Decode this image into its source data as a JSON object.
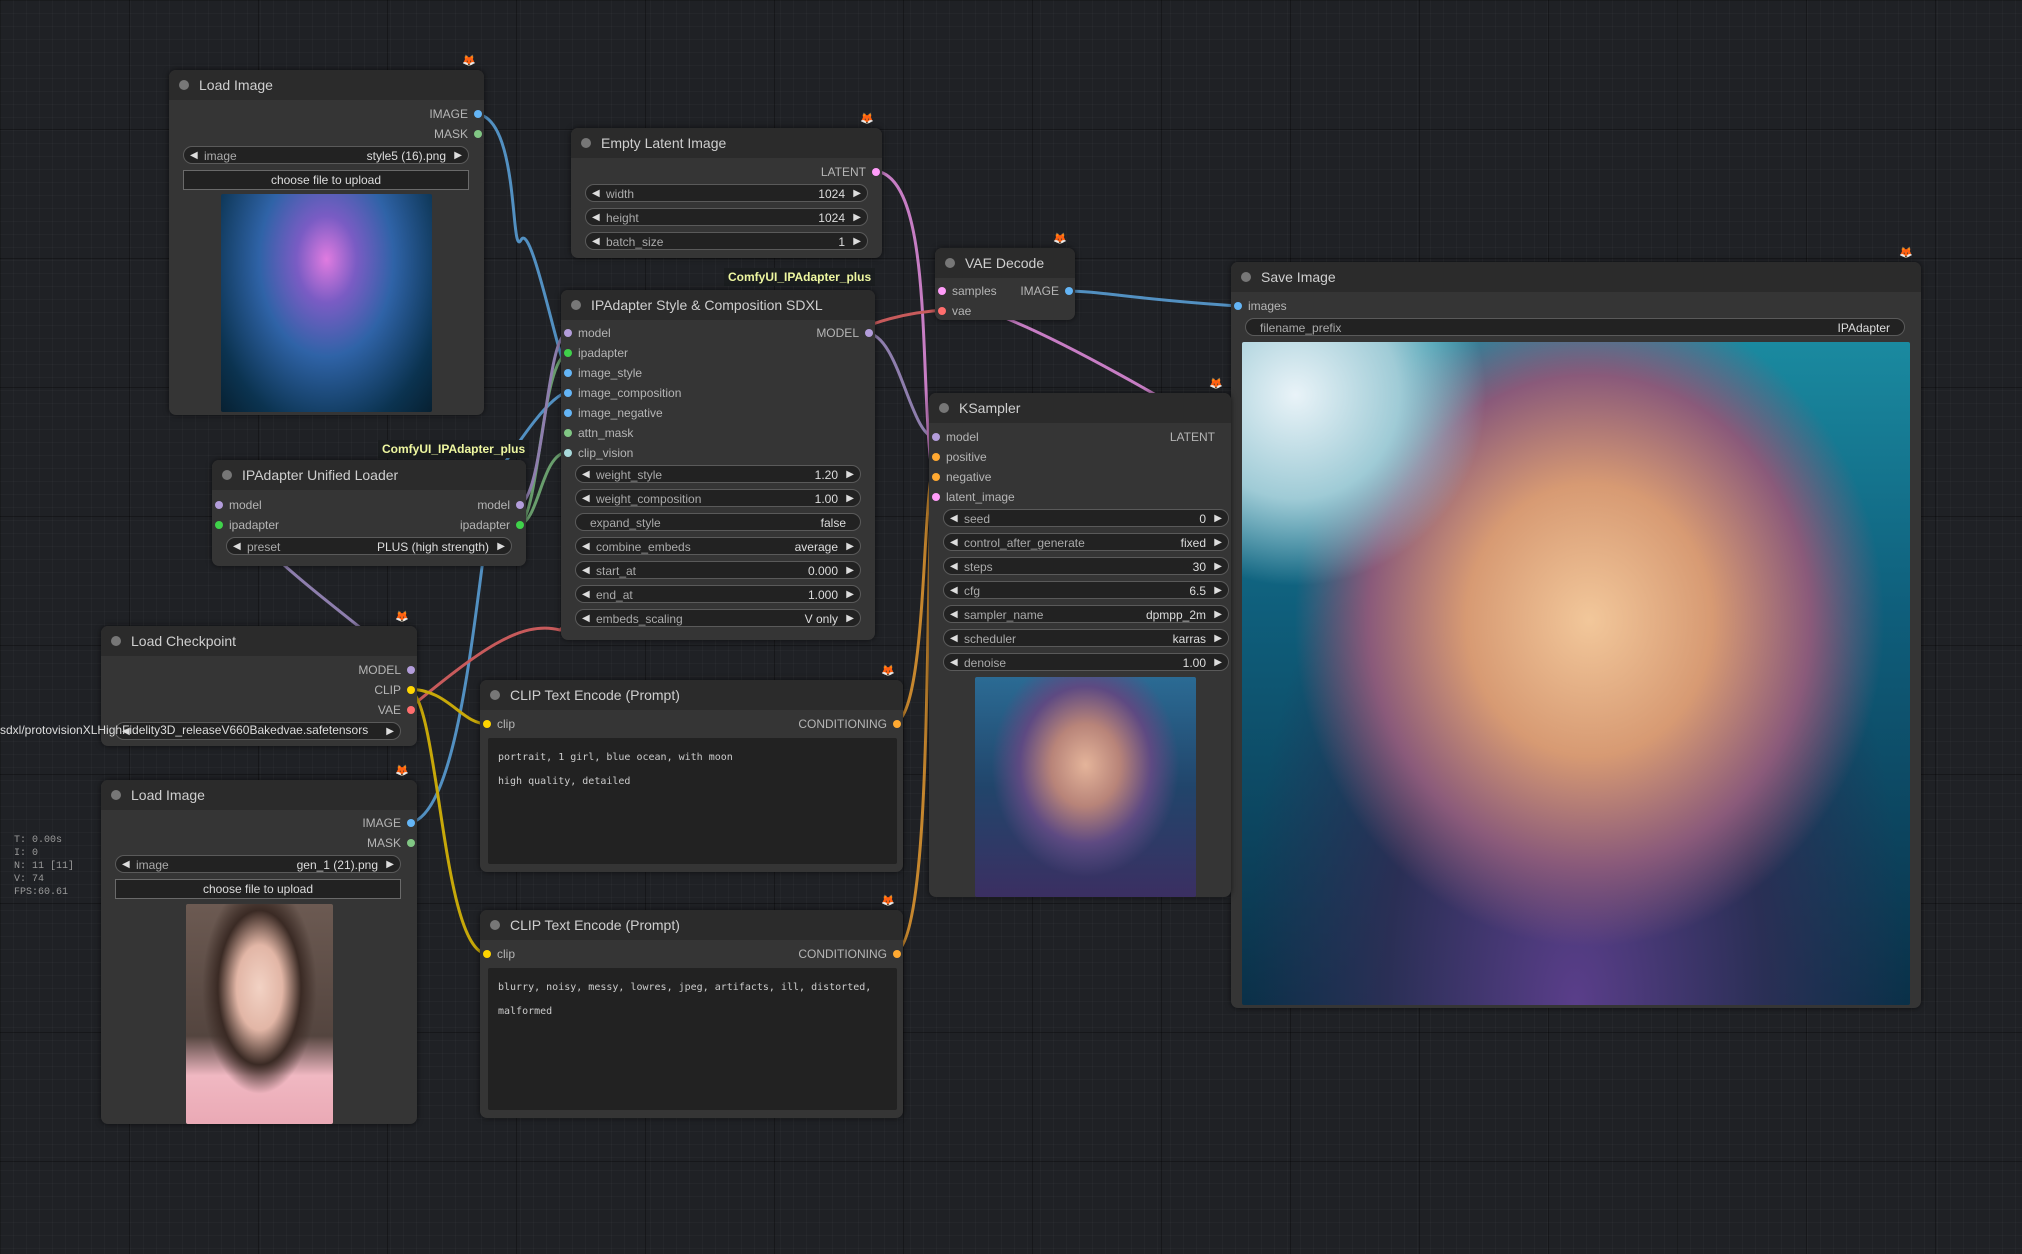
{
  "colors": {
    "model": "#b39ddb",
    "clip": "#ffd500",
    "vae": "#ff6e6e",
    "image": "#64b5f6",
    "latent": "#ff9cf9",
    "conditioning": "#ffa931",
    "mask": "#81c784",
    "ipadapter": "#3fd24a"
  },
  "groups": {
    "ipadapter_plus_a": "ComfyUI_IPAdapter_plus",
    "ipadapter_plus_b": "ComfyUI_IPAdapter_plus"
  },
  "stats": {
    "t": "T: 0.00s",
    "i": "I: 0",
    "n": "N: 11 [11]",
    "v": "V: 74",
    "fps": "FPS:60.61"
  },
  "left_path_label": "sdxl/protovisionXLHighFidelity3D_releaseV660Bakedvae.safetensors",
  "badge_icon": "fox-icon",
  "load_image_1": {
    "title": "Load Image",
    "outputs": [
      "IMAGE",
      "MASK"
    ],
    "image_label": "image",
    "image_value": "style5 (16).png",
    "upload": "choose file to upload",
    "preview": "jellyfish-preview"
  },
  "empty_latent": {
    "title": "Empty Latent Image",
    "output": "LATENT",
    "width_label": "width",
    "width_value": "1024",
    "height_label": "height",
    "height_value": "1024",
    "batch_label": "batch_size",
    "batch_value": "1"
  },
  "vae_decode": {
    "title": "VAE Decode",
    "in_samples": "samples",
    "in_vae": "vae",
    "output": "IMAGE"
  },
  "save_image": {
    "title": "Save Image",
    "in_images": "images",
    "prefix_label": "filename_prefix",
    "prefix_value": "IPAdapter"
  },
  "ipa_style": {
    "title": "IPAdapter Style & Composition SDXL",
    "inputs": [
      "model",
      "ipadapter",
      "image_style",
      "image_composition",
      "image_negative",
      "attn_mask",
      "clip_vision"
    ],
    "output": "MODEL",
    "widgets": [
      {
        "label": "weight_style",
        "value": "1.20"
      },
      {
        "label": "weight_composition",
        "value": "1.00"
      },
      {
        "label": "expand_style",
        "value": "false"
      },
      {
        "label": "combine_embeds",
        "value": "average"
      },
      {
        "label": "start_at",
        "value": "0.000"
      },
      {
        "label": "end_at",
        "value": "1.000"
      },
      {
        "label": "embeds_scaling",
        "value": "V only"
      }
    ]
  },
  "unified_loader": {
    "title": "IPAdapter Unified Loader",
    "in_model": "model",
    "in_ipadapter": "ipadapter",
    "out_model": "model",
    "out_ipadapter": "ipadapter",
    "preset_label": "preset",
    "preset_value": "PLUS (high strength)"
  },
  "load_checkpoint": {
    "title": "Load Checkpoint",
    "outputs": [
      "MODEL",
      "CLIP",
      "VAE"
    ],
    "ckpt_value": "sdxl/protovisionXLHighFidelity3D_releaseV660Bakedvae.safetensors"
  },
  "load_image_2": {
    "title": "Load Image",
    "outputs": [
      "IMAGE",
      "MASK"
    ],
    "image_label": "image",
    "image_value": "gen_1 (21).png",
    "upload": "choose file to upload"
  },
  "clip_pos": {
    "title": "CLIP Text Encode (Prompt)",
    "in_clip": "clip",
    "output": "CONDITIONING",
    "text": "portrait, 1 girl, blue ocean, with moon\nhigh quality, detailed"
  },
  "clip_neg": {
    "title": "CLIP Text Encode (Prompt)",
    "in_clip": "clip",
    "output": "CONDITIONING",
    "text": "blurry, noisy, messy, lowres, jpeg, artifacts, ill, distorted, malformed"
  },
  "ksampler": {
    "title": "KSampler",
    "inputs": [
      "model",
      "positive",
      "negative",
      "latent_image"
    ],
    "output": "LATENT",
    "widgets": [
      {
        "label": "seed",
        "value": "0"
      },
      {
        "label": "control_after_generate",
        "value": "fixed"
      },
      {
        "label": "steps",
        "value": "30"
      },
      {
        "label": "cfg",
        "value": "6.5"
      },
      {
        "label": "sampler_name",
        "value": "dpmpp_2m"
      },
      {
        "label": "scheduler",
        "value": "karras"
      },
      {
        "label": "denoise",
        "value": "1.00"
      }
    ]
  }
}
